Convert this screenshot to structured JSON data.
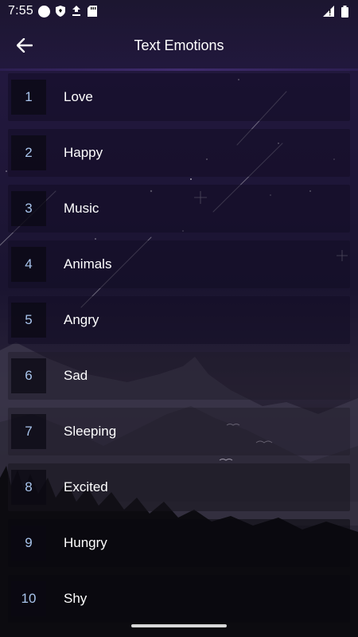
{
  "status_bar": {
    "time": "7:55",
    "icons_left": [
      "circle-icon",
      "shield-icon",
      "download-icon",
      "sd-card-icon"
    ],
    "icons_right": [
      "signal-icon",
      "battery-icon"
    ]
  },
  "app_bar": {
    "back_icon": "arrow-left-icon",
    "title": "Text Emotions"
  },
  "emotions": [
    {
      "number": "1",
      "label": "Love"
    },
    {
      "number": "2",
      "label": "Happy"
    },
    {
      "number": "3",
      "label": "Music"
    },
    {
      "number": "4",
      "label": "Animals"
    },
    {
      "number": "5",
      "label": "Angry"
    },
    {
      "number": "6",
      "label": "Sad"
    },
    {
      "number": "7",
      "label": "Sleeping"
    },
    {
      "number": "8",
      "label": "Excited"
    },
    {
      "number": "9",
      "label": "Hungry"
    },
    {
      "number": "10",
      "label": "Shy"
    }
  ],
  "colors": {
    "number_text": "#a8c4ec",
    "label_text": "#ffffff",
    "accent_purple": "#2b1f52"
  }
}
